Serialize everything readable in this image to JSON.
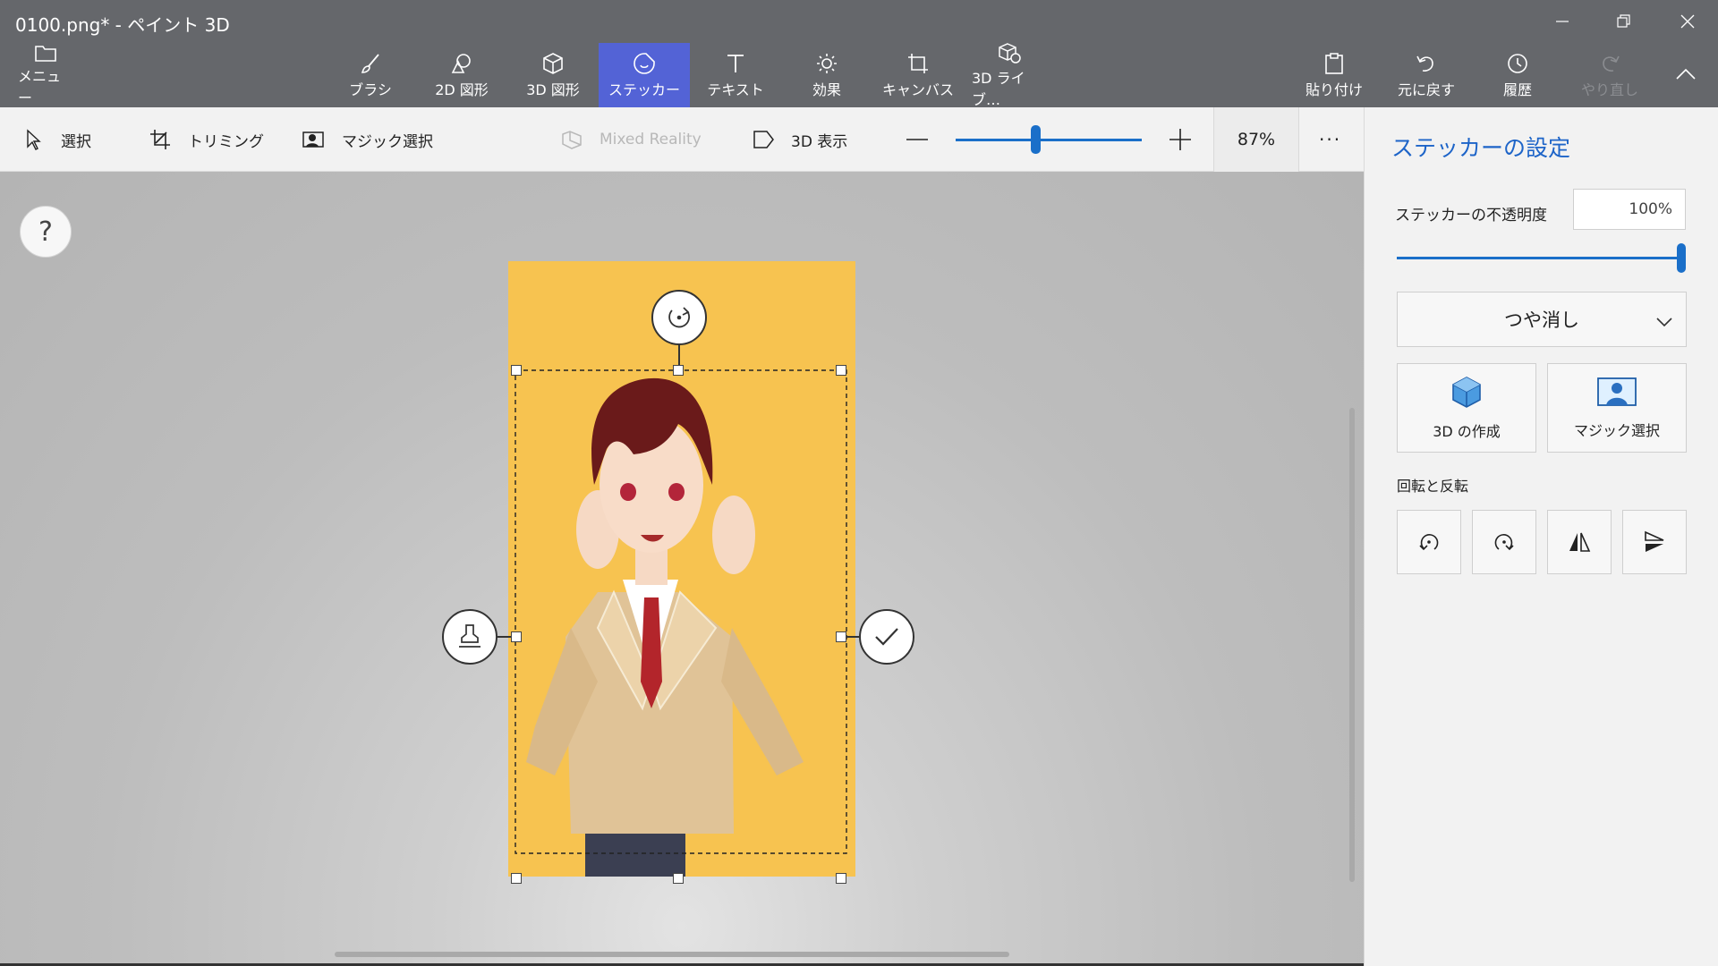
{
  "window": {
    "title": "0100.png* - ペイント 3D"
  },
  "ribbon": {
    "menu_label": "メニュー",
    "tabs": [
      {
        "label": "ブラシ"
      },
      {
        "label": "2D 図形"
      },
      {
        "label": "3D 図形"
      },
      {
        "label": "ステッカー"
      },
      {
        "label": "テキスト"
      },
      {
        "label": "効果"
      },
      {
        "label": "キャンバス"
      },
      {
        "label": "3D ライブ…"
      }
    ],
    "active_tab": "ステッカー",
    "paste_label": "貼り付け",
    "undo_label": "元に戻す",
    "history_label": "履歴",
    "redo_label": "やり直し"
  },
  "toolbar": {
    "select_label": "選択",
    "crop_label": "トリミング",
    "magic_select_label": "マジック選択",
    "mixed_reality_label": "Mixed Reality",
    "view3d_label": "3D 表示",
    "zoom_value": "87%",
    "zoom_level": 0.43,
    "more_label": "···"
  },
  "canvas": {
    "help_label": "?",
    "background_color": "#f7c350"
  },
  "panel": {
    "title": "ステッカーの設定",
    "opacity_label": "ステッカーの不透明度",
    "opacity_value": "100%",
    "finish_value": "つや消し",
    "make3d_label": "3D の作成",
    "magic_select_label": "マジック選択",
    "rotate_flip_label": "回転と反転"
  },
  "colors": {
    "ribbon_bg": "#65676b",
    "active_tab": "#5363d6",
    "accent_blue": "#1a6fc9"
  }
}
